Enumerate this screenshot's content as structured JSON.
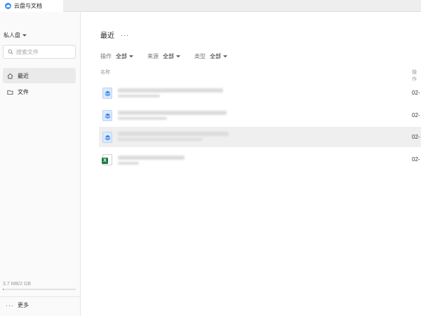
{
  "tab": {
    "title": "云盘与文档"
  },
  "sidebar": {
    "space": "私人盘",
    "search_placeholder": "搜索文件",
    "items": [
      {
        "label": "最近",
        "icon": "home-icon",
        "active": true
      },
      {
        "label": "文件",
        "icon": "folder-icon",
        "active": false
      }
    ],
    "storage": {
      "text": "3.7 MB/2 GB",
      "used_fraction": 0.0018
    },
    "more": {
      "icon_text": "···",
      "label": "更多"
    }
  },
  "main": {
    "title": "最近",
    "title_menu": "···",
    "filters": [
      {
        "label": "操作",
        "value": "全部"
      },
      {
        "label": "来源",
        "value": "全部"
      },
      {
        "label": "类型",
        "value": "全部"
      }
    ],
    "columns": {
      "name": "名称",
      "operation": "操作"
    },
    "rows": [
      {
        "icon": "doc-icon",
        "date": "02-",
        "selected": false
      },
      {
        "icon": "doc-icon",
        "date": "02-",
        "selected": false
      },
      {
        "icon": "doc-icon",
        "date": "02-",
        "selected": true
      },
      {
        "icon": "excel-icon",
        "date": "02-",
        "selected": false
      }
    ]
  },
  "colors": {
    "accent": "#3a8ef6",
    "excel": "#1f7a45",
    "selected_row": "#efefef"
  }
}
